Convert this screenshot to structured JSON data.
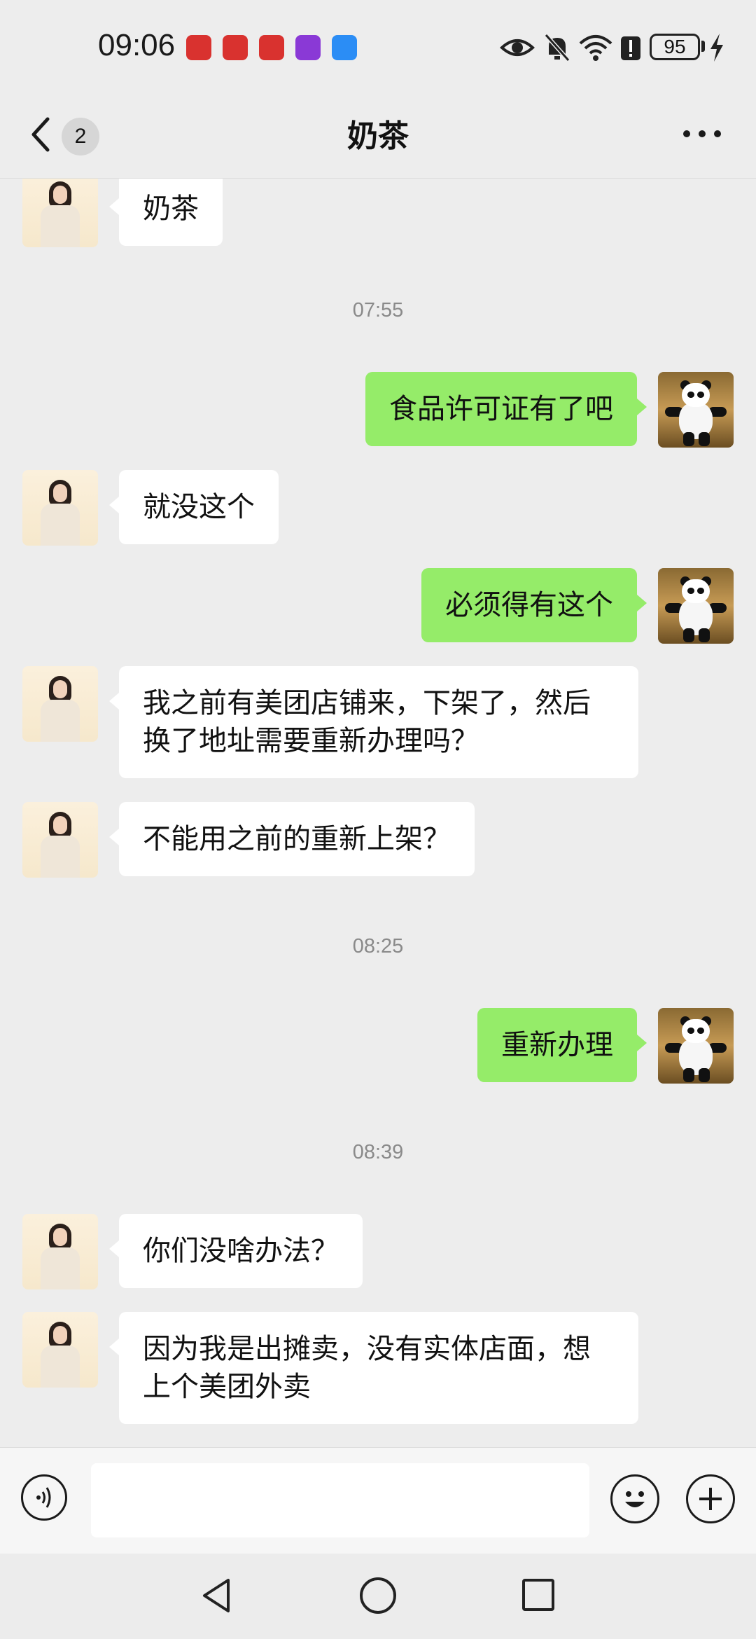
{
  "status_bar": {
    "time": "09:06",
    "battery": "95",
    "icons": [
      "huawei-app-icon",
      "huawei-app-icon",
      "huawei-app-icon",
      "purple-app-icon",
      "blue-app-icon",
      "eye-icon",
      "mute-bell-icon",
      "wifi-icon",
      "alert-icon",
      "battery-icon",
      "charging-icon"
    ]
  },
  "header": {
    "unread_count": "2",
    "title": "奶茶"
  },
  "messages": [
    {
      "sender": "them",
      "text": "奶茶"
    },
    {
      "timestamp": "07:55"
    },
    {
      "sender": "me",
      "text": "食品许可证有了吧"
    },
    {
      "sender": "them",
      "text": "就没这个"
    },
    {
      "sender": "me",
      "text": "必须得有这个"
    },
    {
      "sender": "them",
      "text": "我之前有美团店铺来，下架了，然后换了地址需要重新办理吗？"
    },
    {
      "sender": "them",
      "text": "不能用之前的重新上架？"
    },
    {
      "timestamp": "08:25"
    },
    {
      "sender": "me",
      "text": "重新办理"
    },
    {
      "timestamp": "08:39"
    },
    {
      "sender": "them",
      "text": "你们没啥办法？"
    },
    {
      "sender": "them",
      "text": "因为我是出摊卖，没有实体店面，想上个美团外卖"
    }
  ],
  "colors": {
    "background": "#ededed",
    "incoming_bubble": "#ffffff",
    "outgoing_bubble": "#95ec69"
  }
}
